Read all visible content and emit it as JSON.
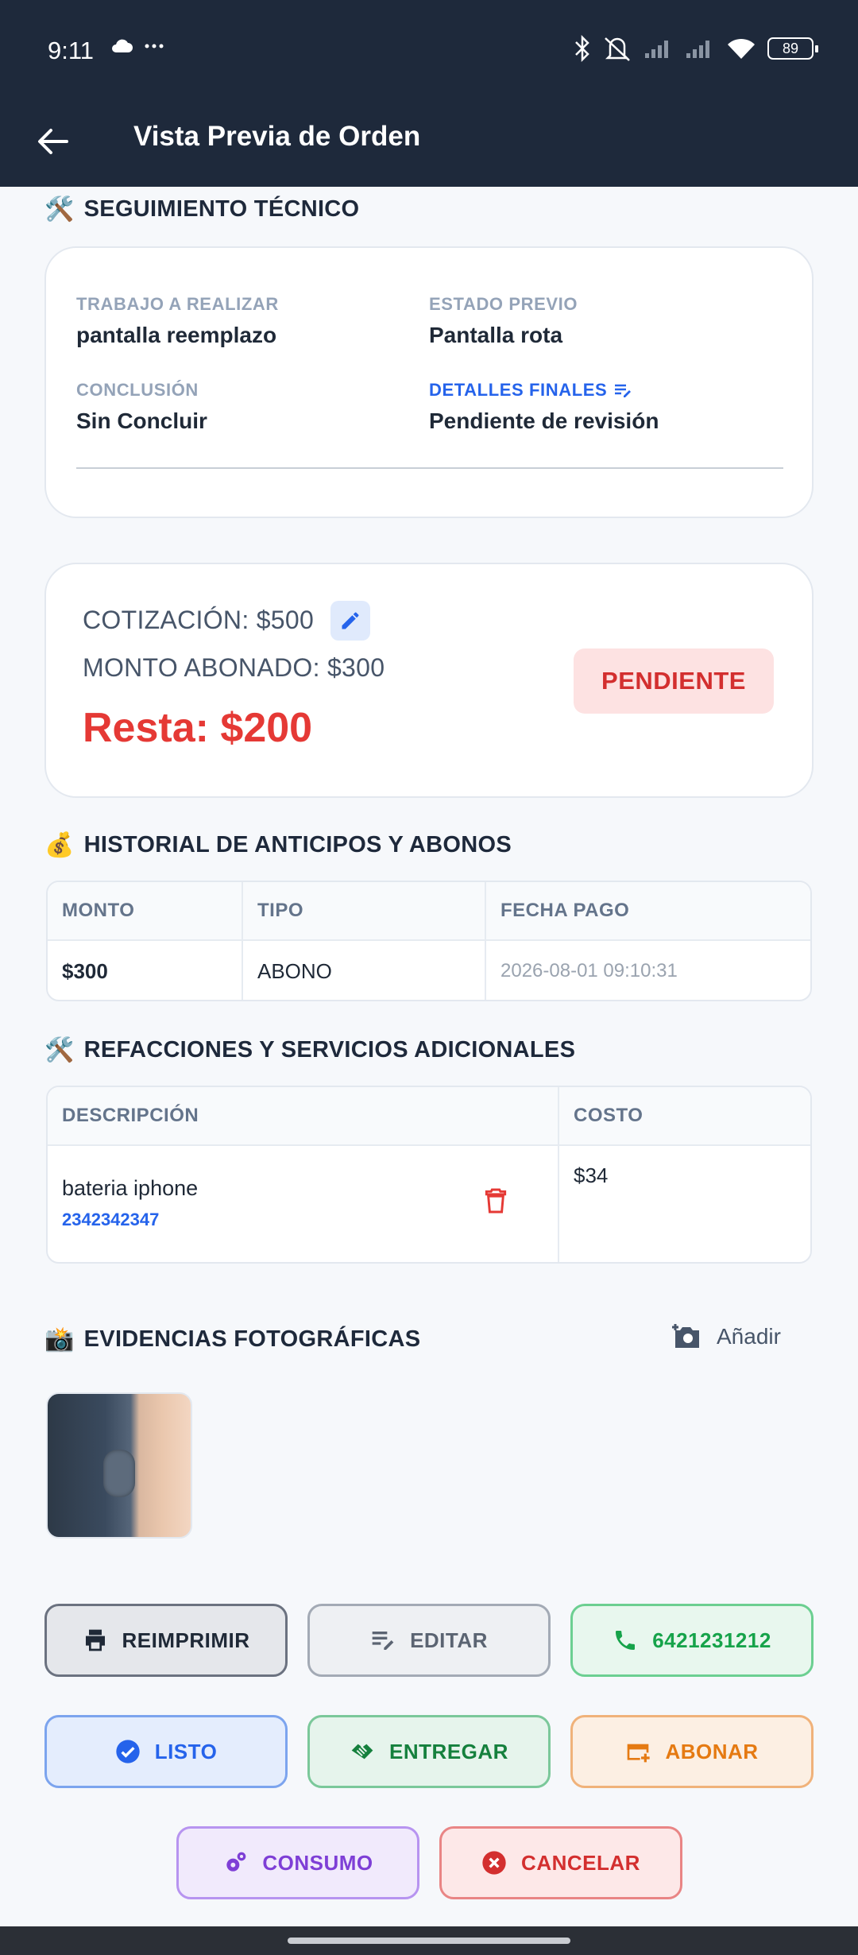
{
  "status_bar": {
    "time": "9:11",
    "battery": "89",
    "icons": [
      "cloud-icon",
      "more-dots-icon",
      "bluetooth-icon",
      "mute-icon",
      "signal-icon",
      "signal-icon",
      "wifi-icon",
      "battery-icon"
    ]
  },
  "app_bar": {
    "title": "Vista Previa de Orden",
    "back_icon": "arrow-back-icon"
  },
  "tech": {
    "title": "SEGUIMIENTO TÉCNICO",
    "emoji": "🛠️",
    "trabajo_label": "TRABAJO A REALIZAR",
    "trabajo_value": "pantalla reemplazo",
    "estado_label": "ESTADO PREVIO",
    "estado_value": "Pantalla rota",
    "conclusion_label": "CONCLUSIÓN",
    "conclusion_value": "Sin Concluir",
    "detalles_label": "DETALLES FINALES",
    "detalles_value": "Pendiente de revisión"
  },
  "quote": {
    "cotizacion": "COTIZACIÓN: $500",
    "abonado": "MONTO ABONADO: $300",
    "resta": "Resta: $200",
    "status": "PENDIENTE",
    "status_color": "#d32f2f",
    "resta_color": "#e53935"
  },
  "payments": {
    "title": "HISTORIAL DE ANTICIPOS Y ABONOS",
    "emoji": "💰",
    "headers": [
      "MONTO",
      "TIPO",
      "FECHA PAGO"
    ],
    "rows": [
      {
        "monto": "$300",
        "tipo": "ABONO",
        "fecha": "2026-08-01 09:10:31"
      }
    ]
  },
  "parts": {
    "title": "REFACCIONES Y SERVICIOS ADICIONALES",
    "emoji": "🛠️",
    "headers": [
      "DESCRIPCIÓN",
      "COSTO"
    ],
    "rows": [
      {
        "descripcion": "bateria iphone",
        "codigo": "2342342347",
        "costo": "$34"
      }
    ]
  },
  "photos": {
    "title": "EVIDENCIAS FOTOGRÁFICAS",
    "emoji": "📸",
    "add_label": "Añadir"
  },
  "actions": {
    "reimprimir": "REIMPRIMIR",
    "editar": "EDITAR",
    "telefono": "6421231212",
    "listo": "LISTO",
    "entregar": "ENTREGAR",
    "abonar": "ABONAR",
    "consumo": "CONSUMO",
    "cancelar": "CANCELAR"
  }
}
